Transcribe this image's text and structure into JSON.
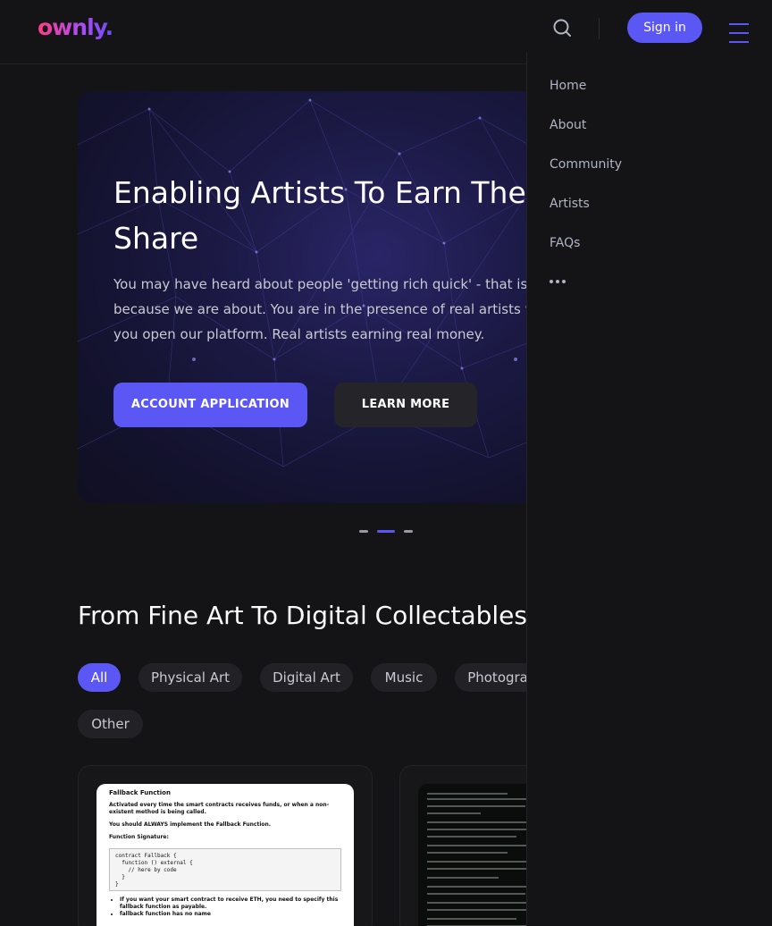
{
  "brand": {
    "logo_text": "ownly."
  },
  "header": {
    "signin_label": "Sign in"
  },
  "hero": {
    "title": "Enabling Artists To Earn Their Share",
    "body": "You may have heard about people 'getting rich quick' - that is because we are about. You are in the presence of real artists when you open our platform. Real artists earning real money.",
    "primary_label": "ACCOUNT APPLICATION",
    "secondary_label": "LEARN MORE",
    "slides_total": 3,
    "active_slide": 2
  },
  "section": {
    "title": "From Fine Art To Digital Collectables"
  },
  "filters": [
    {
      "label": "All",
      "active": true
    },
    {
      "label": "Physical Art",
      "active": false
    },
    {
      "label": "Digital Art",
      "active": false
    },
    {
      "label": "Music",
      "active": false
    },
    {
      "label": "Photography",
      "active": false
    },
    {
      "label": "Other",
      "active": false
    }
  ],
  "cards": [
    {
      "doc_heading": "Fallback Function",
      "doc_line1": "Activated every time the smart contracts receives funds, or when a non-existent method is being called.",
      "doc_line2": "You should ALWAYS implement the Fallback Function.",
      "doc_line3": "Function Signature:",
      "doc_code": "contract Fallback {\n  function () external {\n    // here by code\n  }\n}",
      "doc_bullet1": "If you want your smart contract to receive ETH, you need to specify this fallback function as payable.",
      "doc_bullet2": "fallback function has no name"
    }
  ],
  "menu": {
    "items": [
      "Home",
      "About",
      "Community",
      "Artists",
      "FAQs"
    ]
  },
  "colors": {
    "accent": "#5b57f5",
    "background": "#141416",
    "chip": "#222226"
  },
  "icons": {
    "search": "search-icon",
    "menu": "hamburger-icon",
    "more": "more-horizontal-icon"
  }
}
